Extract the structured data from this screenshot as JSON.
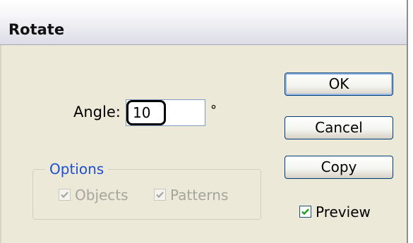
{
  "dialog": {
    "title": "Rotate"
  },
  "angle": {
    "label": "Angle:",
    "value": "10",
    "unit": "°"
  },
  "options": {
    "legend": "Options",
    "objects": {
      "label": "Objects",
      "checked": true,
      "disabled": true
    },
    "patterns": {
      "label": "Patterns",
      "checked": true,
      "disabled": true
    }
  },
  "buttons": {
    "ok": "OK",
    "cancel": "Cancel",
    "copy": "Copy"
  },
  "preview": {
    "label": "Preview",
    "checked": true
  },
  "colors": {
    "checkmark": "#21a121",
    "disabled_checkmark": "#a6a59b",
    "group_label": "#1f4fd0"
  },
  "icons": {
    "check": "check-icon"
  }
}
